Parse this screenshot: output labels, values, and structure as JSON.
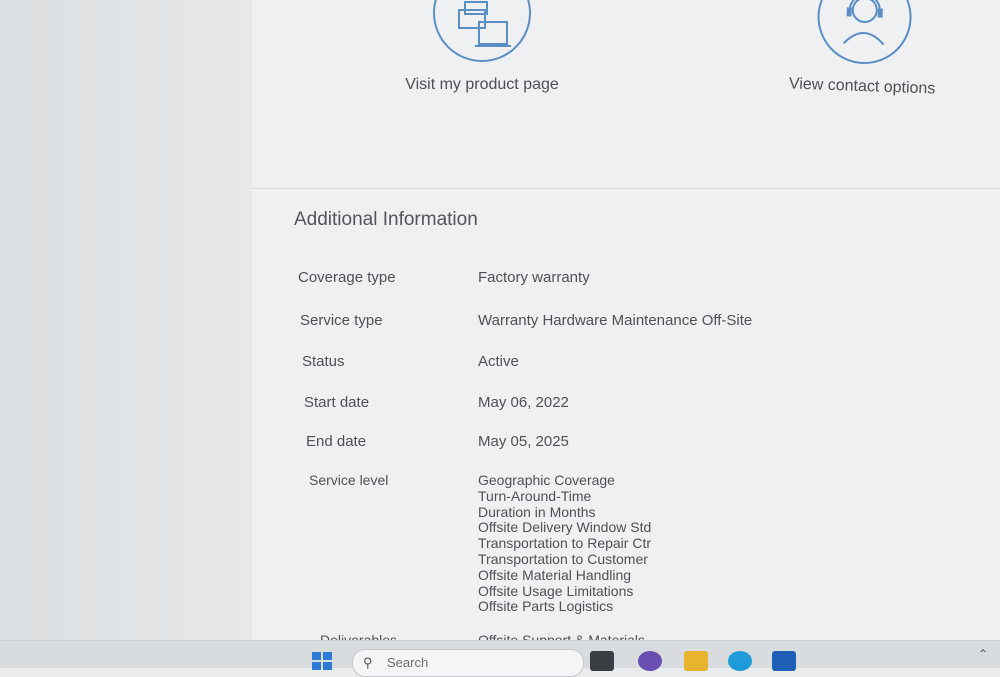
{
  "actions": {
    "product_page_label": "Visit my product page",
    "contact_label": "View contact options"
  },
  "section": {
    "title": "Additional Information"
  },
  "details": [
    {
      "key": "Coverage type",
      "value": "Factory warranty"
    },
    {
      "key": "Service type",
      "value": "Warranty Hardware Maintenance Off-Site"
    },
    {
      "key": "Status",
      "value": "Active"
    },
    {
      "key": "Start date",
      "value": "May 06, 2022"
    },
    {
      "key": "End date",
      "value": "May 05, 2025"
    }
  ],
  "service_level": {
    "label": "Service level",
    "items": [
      "Geographic Coverage",
      "Turn-Around-Time",
      "Duration in Months",
      "Offsite Delivery Window Std",
      "Transportation to Repair Ctr",
      "Transportation to Customer",
      "Offsite Material Handling",
      "Offsite Usage Limitations",
      "Offsite Parts Logistics"
    ]
  },
  "deliverables": {
    "label": "Deliverables",
    "value": "Offsite Support & Materials"
  },
  "taskbar": {
    "search_placeholder": "Search"
  },
  "colors": {
    "accent_blue": "#5a8ec4",
    "text": "#4e5157"
  }
}
